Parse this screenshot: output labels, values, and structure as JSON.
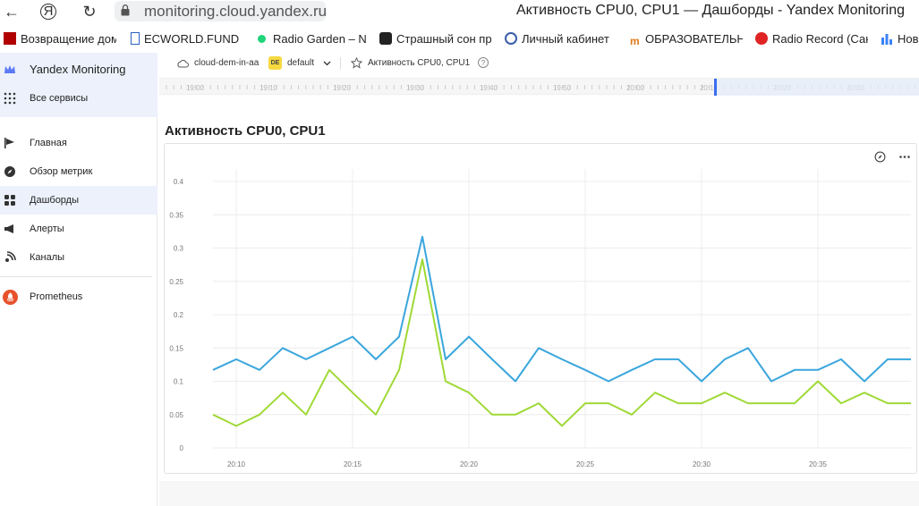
{
  "browser": {
    "url": "monitoring.cloud.yandex.ru",
    "title": "Активность CPU0, CPU1 — Дашборды - Yandex Monitoring",
    "back_icon": "←",
    "yandex_icon": "Я",
    "reload_icon": "↻"
  },
  "bookmarks": [
    {
      "label": "Возвращение дом",
      "icon": "game-icon",
      "color": "#b00000"
    },
    {
      "label": "ECWORLD.FUND |",
      "icon": "document-icon",
      "color": "#2a5fc1"
    },
    {
      "label": "Radio Garden – Na",
      "icon": "dot-icon",
      "color": "#1fd47a"
    },
    {
      "label": "Страшный сон пр",
      "icon": "star-badge-icon",
      "color": "#222"
    },
    {
      "label": "Личный кабинет",
      "icon": "emblem-icon",
      "color": "#3a5ea8"
    },
    {
      "label": "ОБРАЗОВАТЕЛЬН",
      "icon": "m-logo-icon",
      "color": "#e07a1a"
    },
    {
      "label": "Radio Record (Сан",
      "icon": "play-icon",
      "color": "#e02424"
    },
    {
      "label": "Нов",
      "icon": "bars-icon",
      "color": "#3b82f6"
    }
  ],
  "sidebar": {
    "app_name": "Yandex Monitoring",
    "all_services": "Все сервисы",
    "items": [
      {
        "label": "Главная",
        "icon": "flag-icon"
      },
      {
        "label": "Обзор метрик",
        "icon": "compass-icon"
      },
      {
        "label": "Дашборды",
        "icon": "grid-icon",
        "active": true
      },
      {
        "label": "Алерты",
        "icon": "megaphone-icon"
      },
      {
        "label": "Каналы",
        "icon": "signal-icon"
      }
    ],
    "prometheus": "Prometheus",
    "accent": "#ecf1fb"
  },
  "breadcrumbs": {
    "cloud": "cloud-dem-in-aa",
    "folder_badge": "DE",
    "folder": "default",
    "dashboard": "Активность CPU0, CPU1"
  },
  "timeline": {
    "labels": [
      "19:00",
      "19:10",
      "19:20",
      "19:30",
      "19:40",
      "19:50",
      "20:00",
      "20:10",
      "20:20",
      "20:30"
    ]
  },
  "chart_title": "Активность CPU0, CPU1",
  "chart_data": {
    "type": "line",
    "x": [
      "20:09",
      "20:10",
      "20:11",
      "20:12",
      "20:13",
      "20:14",
      "20:15",
      "20:16",
      "20:17",
      "20:18",
      "20:19",
      "20:20",
      "20:21",
      "20:22",
      "20:23",
      "20:24",
      "20:25",
      "20:26",
      "20:27",
      "20:28",
      "20:29",
      "20:30",
      "20:31",
      "20:32",
      "20:33",
      "20:34",
      "20:35",
      "20:36",
      "20:37",
      "20:38",
      "20:39"
    ],
    "x_tick_labels": [
      "20:10",
      "20:15",
      "20:20",
      "20:25",
      "20:30",
      "20:35"
    ],
    "y_tick_labels": [
      "0",
      "0.05",
      "0.1",
      "0.15",
      "0.2",
      "0.25",
      "0.3",
      "0.35",
      "0.4"
    ],
    "ylim": [
      0,
      0.4
    ],
    "grid": true,
    "series": [
      {
        "color": "#3aa6dd",
        "values": [
          0.117,
          0.133,
          0.117,
          0.15,
          0.133,
          0.15,
          0.167,
          0.133,
          0.167,
          0.317,
          0.133,
          0.167,
          0.133,
          0.1,
          0.15,
          0.133,
          0.117,
          0.1,
          0.117,
          0.133,
          0.133,
          0.1,
          0.133,
          0.15,
          0.1,
          0.117,
          0.117,
          0.133,
          0.1,
          0.133,
          0.133
        ]
      },
      {
        "color": "#9fd936",
        "values": [
          0.05,
          0.033,
          0.05,
          0.083,
          0.05,
          0.117,
          0.083,
          0.05,
          0.117,
          0.283,
          0.1,
          0.083,
          0.05,
          0.05,
          0.067,
          0.033,
          0.067,
          0.067,
          0.05,
          0.083,
          0.067,
          0.067,
          0.083,
          0.067,
          0.067,
          0.067,
          0.1,
          0.067,
          0.083,
          0.067,
          0.067
        ]
      }
    ]
  }
}
